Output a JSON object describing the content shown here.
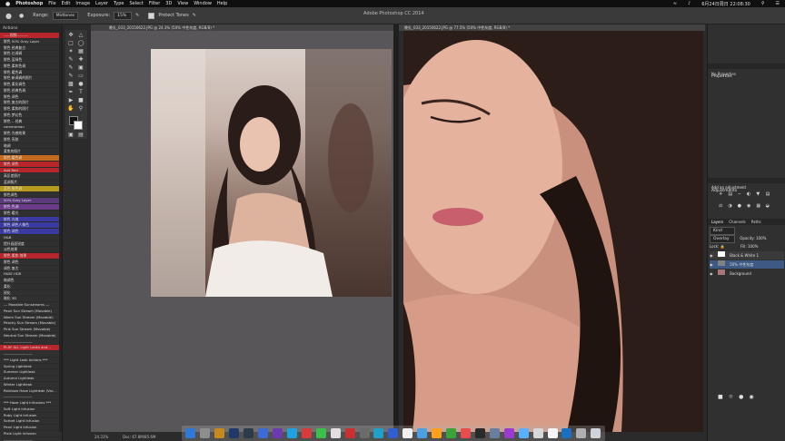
{
  "menubar": {
    "apple": "",
    "app": "Photoshop",
    "items": [
      "File",
      "Edit",
      "Image",
      "Layer",
      "Type",
      "Select",
      "Filter",
      "3D",
      "View",
      "Window",
      "Help"
    ],
    "clock": "6月24日周日 22:08:30"
  },
  "options": {
    "range_label": "Range:",
    "range_value": "Midtones",
    "exposure_label": "Exposure:",
    "exposure_value": "15%",
    "protect_label": "Protect Tones",
    "window_title": "Adobe Photoshop CC 2014"
  },
  "actions": {
    "header": "Actions",
    "items": [
      {
        "label": "-----视频---------",
        "bg": "#b7262a"
      },
      {
        "label": "鲜色 50% Gray Layer",
        "bg": ""
      },
      {
        "label": "鲜色 经典复古",
        "bg": ""
      },
      {
        "label": "鲜色 红调调",
        "bg": ""
      },
      {
        "label": "鲜色 蓝绿色",
        "bg": ""
      },
      {
        "label": "鲜色 柔和色调",
        "bg": ""
      },
      {
        "label": "鲜色 暖色调",
        "bg": ""
      },
      {
        "label": "鲜色 新调调的照片",
        "bg": ""
      },
      {
        "label": "鲜色 柔化调色",
        "bg": ""
      },
      {
        "label": "鲜色 经典色调",
        "bg": ""
      },
      {
        "label": "鲜色 调色",
        "bg": ""
      },
      {
        "label": "鲜色 复古的照片",
        "bg": ""
      },
      {
        "label": "鲜色 柔和的照片",
        "bg": ""
      },
      {
        "label": "鲜色 梦幻色",
        "bg": ""
      },
      {
        "label": "鲜色 -- 经典",
        "bg": ""
      },
      {
        "label": "cameraman",
        "bg": ""
      },
      {
        "label": "鲜色 光感效果",
        "bg": ""
      },
      {
        "label": "鲜色 亮肤",
        "bg": ""
      },
      {
        "label": "暗调",
        "bg": ""
      },
      {
        "label": "柔焦的照片",
        "bg": ""
      },
      {
        "label": "鲜色 暖色调",
        "bg": "#c46a1e"
      },
      {
        "label": "鲜色 调色",
        "bg": "#b7262a"
      },
      {
        "label": "Add Red",
        "bg": "#b7262a"
      },
      {
        "label": "高反差照片",
        "bg": ""
      },
      {
        "label": "蓝调照片",
        "bg": ""
      },
      {
        "label": "蓝色 鲜色调",
        "bg": "#b79a1e"
      },
      {
        "label": "鲜色调色",
        "bg": ""
      },
      {
        "label": "50% Grey Layer",
        "bg": "#5a3a7a"
      },
      {
        "label": "鲜色 色调",
        "bg": "#6b3a8a"
      },
      {
        "label": "鲜色 暖光",
        "bg": ""
      },
      {
        "label": "鲜色 光效",
        "bg": "#3a3aa0"
      },
      {
        "label": "鲜色 调色人像色",
        "bg": "#3a3aa0"
      },
      {
        "label": "鲜色 调色",
        "bg": "#3a3aa0"
      },
      {
        "label": "D&B",
        "bg": ""
      },
      {
        "label": "提升画面锐度",
        "bg": ""
      },
      {
        "label": "淡色效果",
        "bg": ""
      },
      {
        "label": "鲜色 柔和 效果",
        "bg": "#b7262a"
      },
      {
        "label": "鲜色 调色",
        "bg": ""
      },
      {
        "label": "调色 复古",
        "bg": ""
      },
      {
        "label": "FADE HDR",
        "bg": ""
      },
      {
        "label": "暗调色",
        "bg": ""
      },
      {
        "label": "柔化",
        "bg": ""
      },
      {
        "label": "锐化",
        "bg": ""
      },
      {
        "label": "暗化 3D",
        "bg": ""
      },
      {
        "label": "--- Movable Sunstreams ---",
        "bg": ""
      },
      {
        "label": "Pearl Sun Stream (Movable)",
        "bg": ""
      },
      {
        "label": "Warm Sun Stream (Movable)",
        "bg": ""
      },
      {
        "label": "Peachy Sun Stream (Movable)",
        "bg": ""
      },
      {
        "label": "Pink Sun Stream (Movable)",
        "bg": ""
      },
      {
        "label": "Neutral Sun Stream (Movable)",
        "bg": ""
      },
      {
        "label": "-----------------------",
        "bg": ""
      },
      {
        "label": "PLAY ALL Light Leaks and...",
        "bg": "#b7262a"
      },
      {
        "label": "-----------------------",
        "bg": ""
      },
      {
        "label": "*** Light Leak Actions ***",
        "bg": ""
      },
      {
        "label": "Spring Lightleak",
        "bg": ""
      },
      {
        "label": "Summer Lightleak",
        "bg": ""
      },
      {
        "label": "Autumn Lightleak",
        "bg": ""
      },
      {
        "label": "Winter Lightleak",
        "bg": ""
      },
      {
        "label": "Rainbow Haze Lightleak (Var...",
        "bg": ""
      },
      {
        "label": "-----------------------",
        "bg": ""
      },
      {
        "label": "*** Haze Light Infusions ***",
        "bg": ""
      },
      {
        "label": "Soft Light Infusion",
        "bg": ""
      },
      {
        "label": "Ruby Light Infusion",
        "bg": ""
      },
      {
        "label": "Sorbet Light Infusion",
        "bg": ""
      },
      {
        "label": "Pearl Light Infusion",
        "bg": ""
      },
      {
        "label": "Pixie Light Infusion",
        "bg": ""
      },
      {
        "label": "-----------------------",
        "bg": ""
      },
      {
        "label": "Lightfilter",
        "bg": "#b7262a"
      },
      {
        "label": "Skin Retouching",
        "bg": "#3a3aa0"
      }
    ]
  },
  "left_doc": {
    "tab": "晚礼_033_20150622.JPG @ 24.3% (50% 中性灰度, RGB/8) *",
    "zoom": "24.31%",
    "doc": "Doc: 67.8M/85.6M"
  },
  "right_doc": {
    "tab": "晚礼_033_20150622.JPG @ 77.5% (50% 中性灰度, RGB/8) *"
  },
  "right_panel": {
    "properties_title": "Properties",
    "properties_value": "No Properties",
    "adjustments_title": "Adjustments",
    "add_adjustment": "Add an adjustment",
    "layers_tabs": [
      "Layers",
      "Channels",
      "Paths"
    ],
    "kind_label": "Kind",
    "blend_mode": "Overlay",
    "opacity_label": "Opacity:",
    "opacity_value": "100%",
    "lock_label": "Lock:",
    "fill_label": "Fill:",
    "fill_value": "100%",
    "layers": [
      {
        "name": "Black & White 1"
      },
      {
        "name": "50% 中性灰度"
      },
      {
        "name": "Background"
      }
    ]
  },
  "colors": {
    "accent_red": "#b7262a",
    "accent_blue": "#3a3aa0",
    "panel": "#303030"
  }
}
